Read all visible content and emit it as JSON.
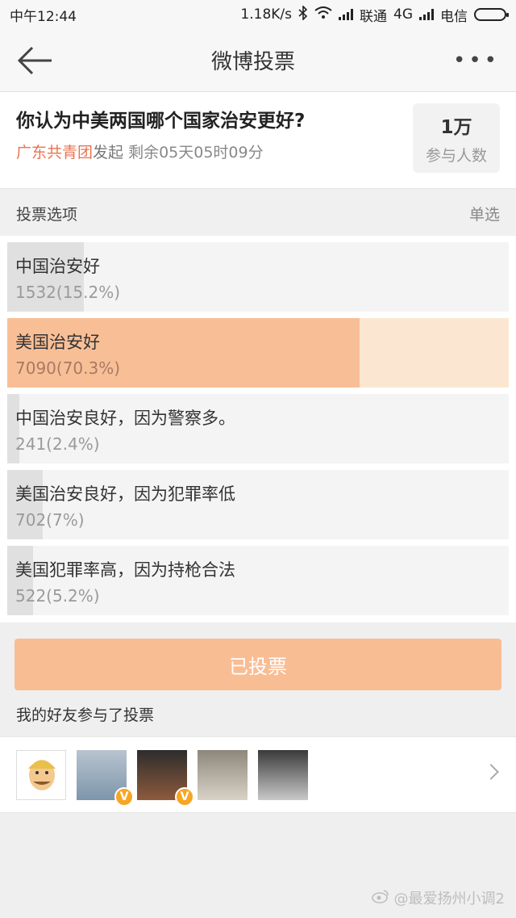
{
  "status_bar": {
    "time": "中午12:44",
    "speed": "1.18K/s",
    "carrier1": "联通",
    "network": "4G",
    "carrier2": "电信"
  },
  "nav": {
    "title": "微博投票",
    "more_icon": "more-dots-icon",
    "back_icon": "back-arrow-icon"
  },
  "poll": {
    "question": "你认为中美两国哪个国家治安更好?",
    "organizer": "广东共青团",
    "initiated": "发起",
    "remaining": "剩余05天05时09分",
    "participant_count": "1万",
    "participant_label": "参与人数"
  },
  "options_header": {
    "title": "投票选项",
    "mode": "单选"
  },
  "options": [
    {
      "label": "中国治安好",
      "stat": "1532(15.2%)",
      "percent": 15.2,
      "selected": false
    },
    {
      "label": "美国治安好",
      "stat": "7090(70.3%)",
      "percent": 70.3,
      "selected": true
    },
    {
      "label": "中国治安良好，因为警察多。",
      "stat": "241(2.4%)",
      "percent": 2.4,
      "selected": false
    },
    {
      "label": "美国治安良好，因为犯罪率低",
      "stat": "702(7%)",
      "percent": 7,
      "selected": false
    },
    {
      "label": "美国犯罪率高，因为持枪合法",
      "stat": "522(5.2%)",
      "percent": 5.2,
      "selected": false
    }
  ],
  "voted_button": "已投票",
  "friends_title": "我的好友参与了投票",
  "friends": [
    {
      "verified": false
    },
    {
      "verified": true,
      "badge": "V"
    },
    {
      "verified": true,
      "badge": "V"
    },
    {
      "verified": false
    },
    {
      "verified": false
    }
  ],
  "watermark": "@最爱扬州小调2",
  "colors": {
    "accent": "#eb7350",
    "selected_fill": "#f8bf97",
    "selected_bg": "#fbe7d1",
    "voted_button": "#f9bd94"
  }
}
